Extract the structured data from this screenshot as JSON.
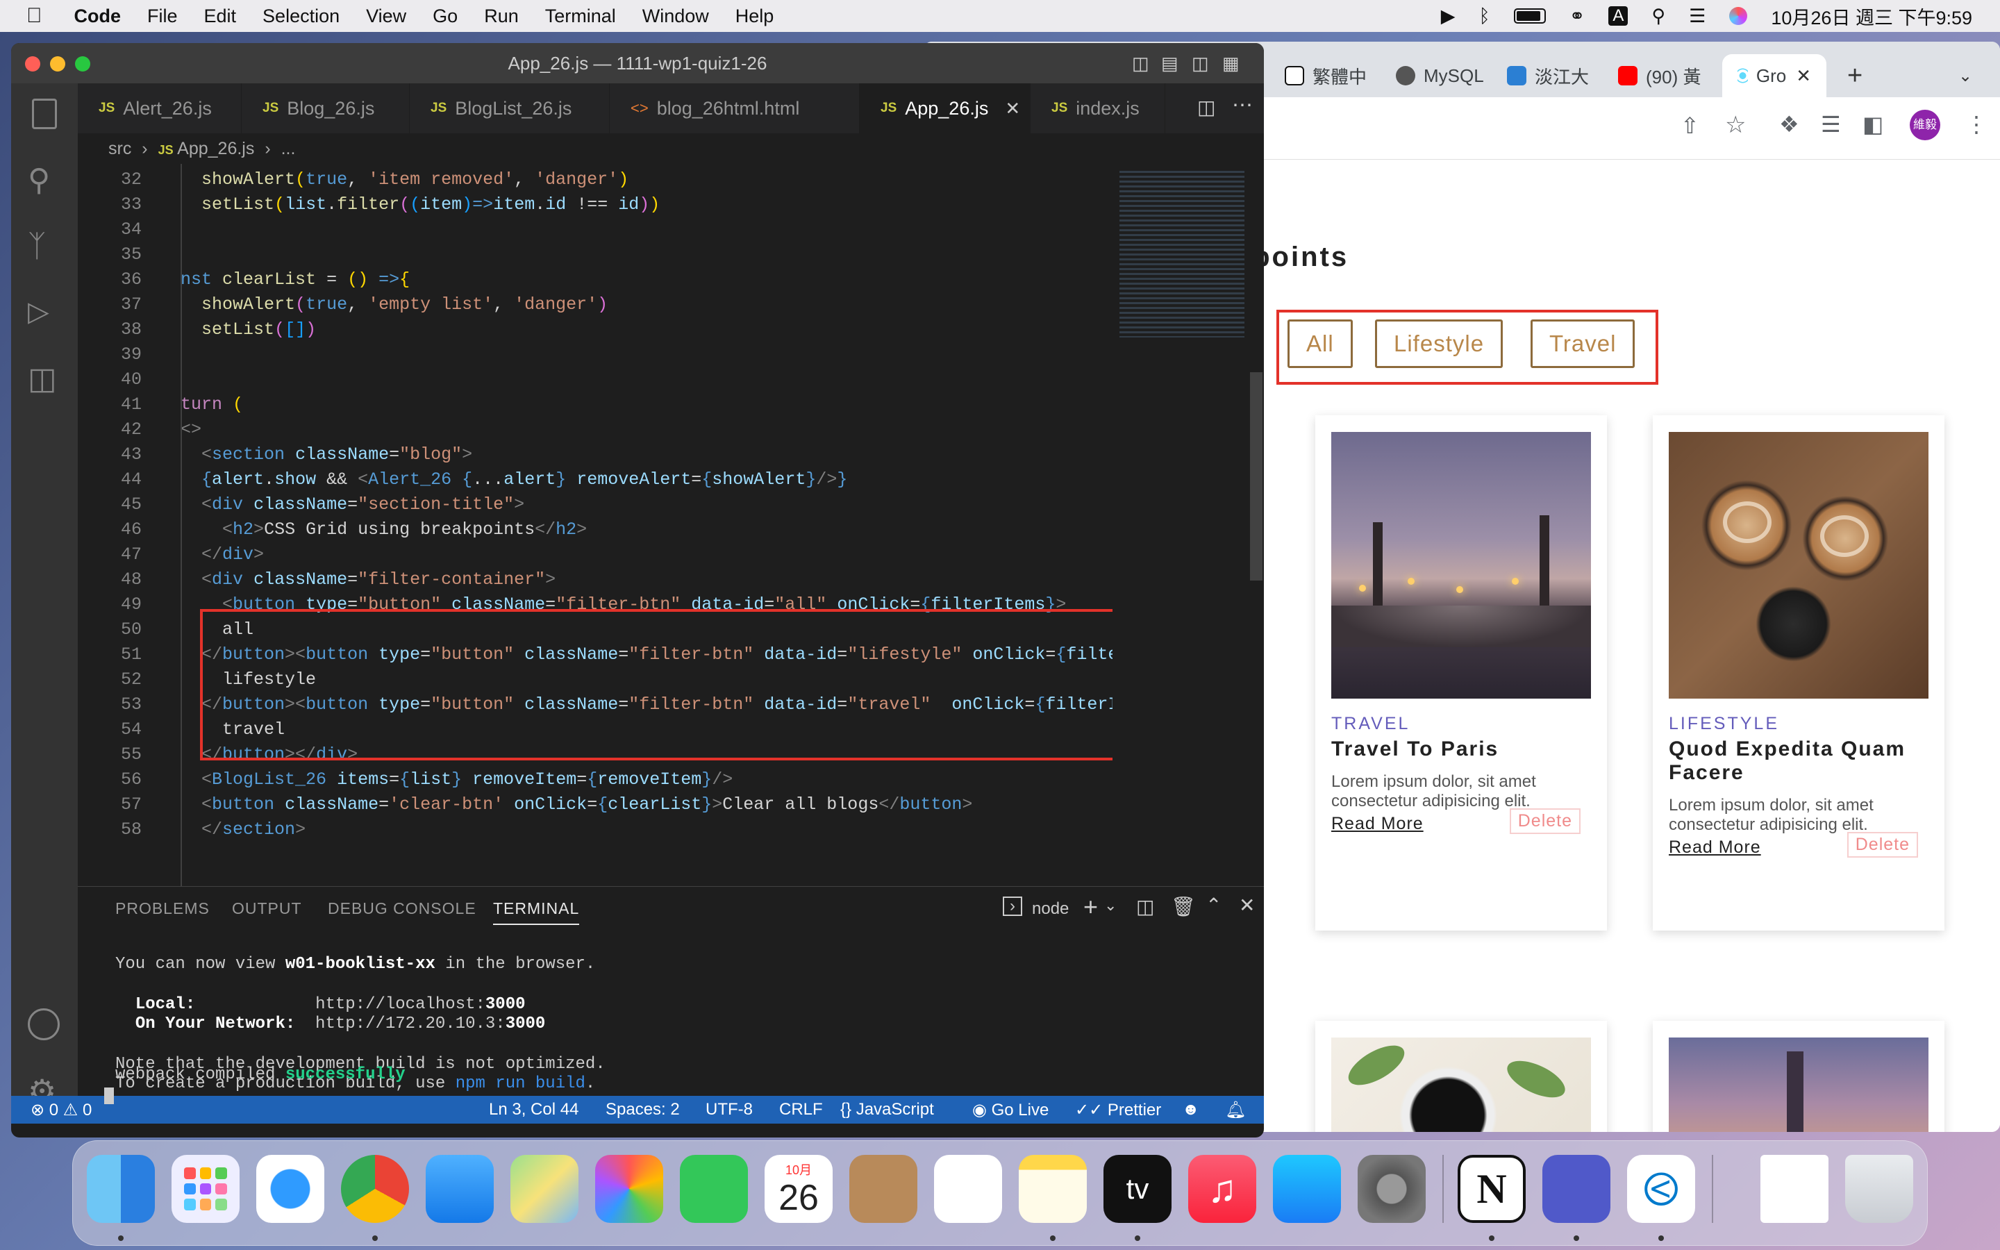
{
  "menubar": {
    "app_name": "Code",
    "items": [
      "File",
      "Edit",
      "Selection",
      "View",
      "Go",
      "Run",
      "Terminal",
      "Window",
      "Help"
    ],
    "datetime": "10月26日 週三 下午9:59",
    "input_indicator": "A"
  },
  "vscode": {
    "title": "App_26.js — 1111-wp1-quiz1-26",
    "tabs": [
      {
        "icon": "JS",
        "label": "Alert_26.js"
      },
      {
        "icon": "JS",
        "label": "Blog_26.js"
      },
      {
        "icon": "JS",
        "label": "BlogList_26.js"
      },
      {
        "icon": "<>",
        "label": "blog_26html.html"
      },
      {
        "icon": "JS",
        "label": "App_26.js",
        "active": true
      },
      {
        "icon": "JS",
        "label": "index.js"
      }
    ],
    "breadcrumb": {
      "root": "src",
      "file_icon": "JS",
      "file": "App_26.js",
      "rest": "..."
    },
    "line_numbers": [
      "32",
      "33",
      "34",
      "35",
      "36",
      "37",
      "38",
      "39",
      "40",
      "41",
      "42",
      "43",
      "44",
      "45",
      "46",
      "47",
      "48",
      "49",
      "50",
      "51",
      "52",
      "53",
      "54",
      "55",
      "56",
      "57",
      "58"
    ],
    "panel": {
      "tabs": [
        "PROBLEMS",
        "OUTPUT",
        "DEBUG CONSOLE",
        "TERMINAL"
      ],
      "active_tab": "TERMINAL",
      "shell": "node",
      "lines": [
        "You can now view w01-booklist-xx in the browser.",
        "  Local:            http://localhost:3000",
        "  On Your Network:  http://172.20.10.3:3000",
        "Note that the development build is not optimized.",
        "To create a production build, use npm run build.",
        "webpack compiled successfully"
      ]
    },
    "status": {
      "errors": "0",
      "warnings": "0",
      "position": "Ln 3, Col 44",
      "spaces": "Spaces: 2",
      "encoding": "UTF-8",
      "eol": "CRLF",
      "language": "JavaScript",
      "golive": "Go Live",
      "prettier": "Prettier"
    }
  },
  "chrome": {
    "tabs": [
      {
        "label": "繁體中"
      },
      {
        "label": "MySQL"
      },
      {
        "label": "淡江大"
      },
      {
        "label": "(90) 黃"
      },
      {
        "label": "Gro",
        "active": true
      }
    ],
    "profile": "維毅"
  },
  "page": {
    "title": "CSS Grid Using Breakpoints",
    "filters": [
      "All",
      "Lifestyle",
      "Travel"
    ],
    "cards": [
      {
        "category": "TRAVEL",
        "title": "Travel To Paris",
        "desc": "Lorem ipsum dolor, sit amet consectetur adipisicing elit.",
        "read": "Read More",
        "delete": "Delete"
      },
      {
        "category": "LIFESTYLE",
        "title": "Quod Expedita Quam Facere",
        "desc": "Lorem ipsum dolor, sit amet consectetur adipisicing elit.",
        "read": "Read More",
        "delete": "Delete"
      }
    ]
  },
  "dock": {
    "calendar_month": "10月",
    "calendar_day": "26",
    "tv_label": "tv"
  }
}
